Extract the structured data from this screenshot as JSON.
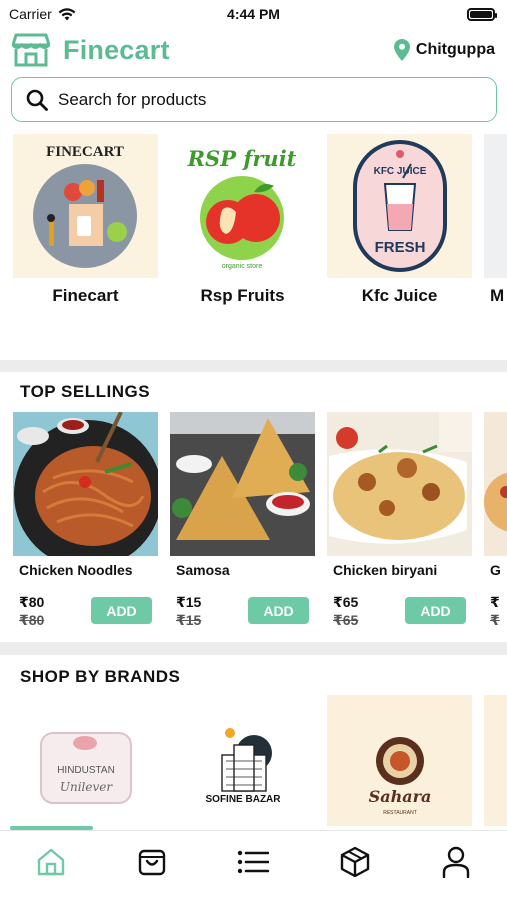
{
  "status_bar": {
    "carrier": "Carrier",
    "time": "4:44 PM"
  },
  "header": {
    "app_name": "Finecart",
    "location": "Chitguppa",
    "brand_color": "#5dbb94"
  },
  "search": {
    "placeholder": "Search for products"
  },
  "stores": [
    {
      "name": "Finecart",
      "logo_text": "FINECART"
    },
    {
      "name": "Rsp Fruits",
      "logo_text": "RSP fruit",
      "logo_sub": "organic store"
    },
    {
      "name": "Kfc Juice",
      "logo_text": "KFC JUICE",
      "logo_sub": "FRESH"
    },
    {
      "name": "M"
    }
  ],
  "top_sellings": {
    "title": "TOP SELLINGS",
    "add_label": "ADD",
    "products": [
      {
        "name": "Chicken Noodles",
        "price": "₹80",
        "mrp": "₹80"
      },
      {
        "name": "Samosa",
        "price": "₹15",
        "mrp": "₹15"
      },
      {
        "name": "Chicken biryani",
        "price": "₹65",
        "mrp": "₹65"
      },
      {
        "name": "G",
        "price": "₹",
        "mrp": "₹"
      }
    ]
  },
  "brands": {
    "title": "SHOP BY BRANDS",
    "items": [
      {
        "name": "HINDUSTAN",
        "sub": "Unilever"
      },
      {
        "name": "SOFINE BAZAR"
      },
      {
        "name": "Sahara",
        "sub": "RESTAURANT"
      }
    ]
  },
  "tabs": [
    {
      "icon": "home-icon"
    },
    {
      "icon": "shopping-bag-icon"
    },
    {
      "icon": "list-icon"
    },
    {
      "icon": "box-icon"
    },
    {
      "icon": "user-icon"
    }
  ],
  "accent": "#6ec9a6"
}
